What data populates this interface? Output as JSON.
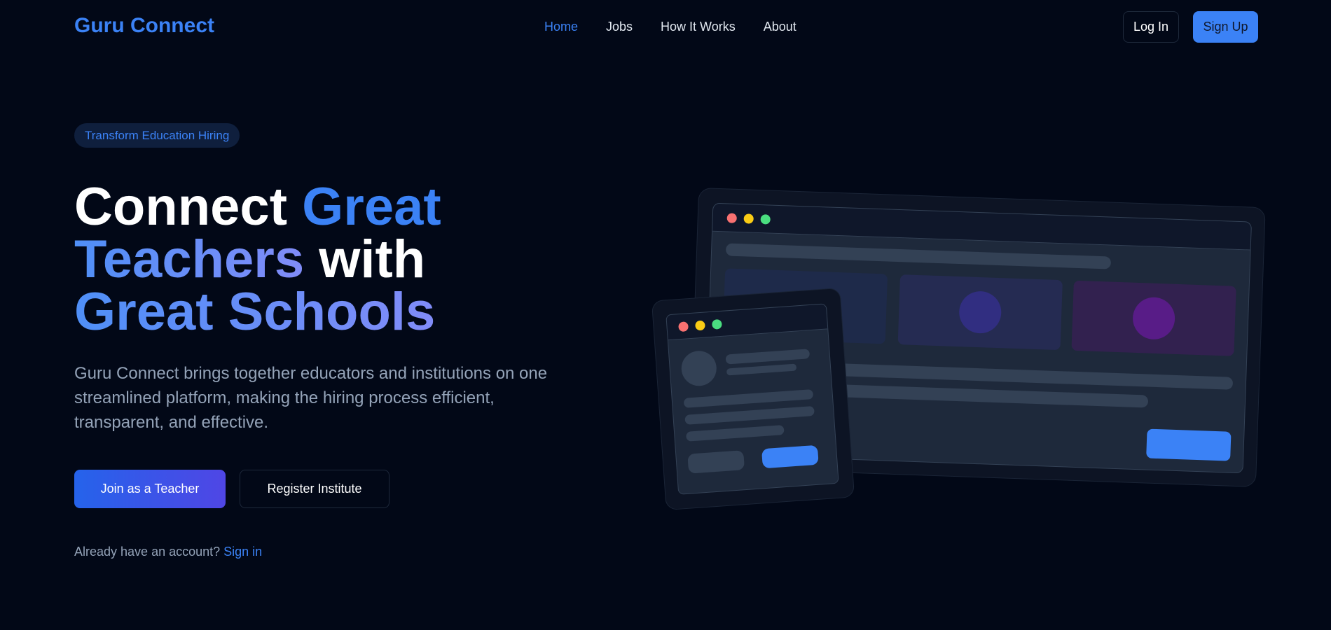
{
  "brand": {
    "name": "Guru Connect"
  },
  "nav": {
    "links": [
      {
        "label": "Home",
        "active": true
      },
      {
        "label": "Jobs"
      },
      {
        "label": "How It Works"
      },
      {
        "label": "About"
      }
    ],
    "login_label": "Log In",
    "signup_label": "Sign Up"
  },
  "hero": {
    "badge": "Transform Education Hiring",
    "headline": {
      "part1": "Connect ",
      "part2": "Great",
      "part3": "Teachers",
      "part4": " with",
      "part5": "Great Schools"
    },
    "description": "Guru Connect brings together educators and institutions on one streamlined platform, making the hiring process efficient, transparent, and effective.",
    "primary_cta": "Join as a Teacher",
    "secondary_cta": "Register Institute",
    "signin_prompt": "Already have an account? ",
    "signin_link": "Sign in"
  },
  "colors": {
    "background": "#020817",
    "accent": "#3b82f6",
    "gradient_end": "#818cf8"
  }
}
